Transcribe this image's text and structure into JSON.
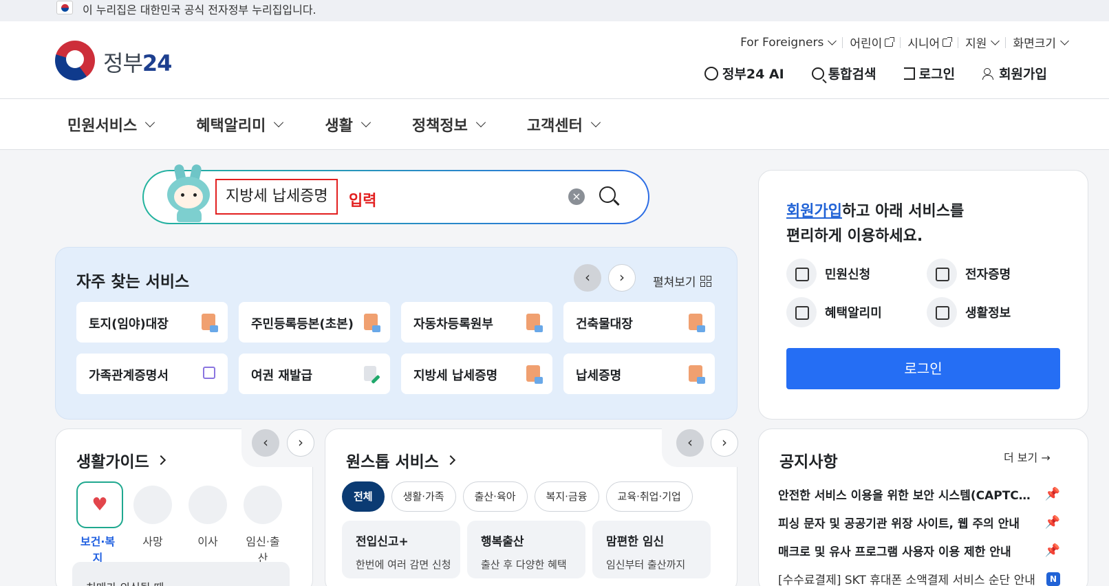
{
  "topbar": {
    "text": "이 누리집은 대한민국 공식 전자정부 누리집입니다."
  },
  "logo": {
    "text": "정부",
    "num": "24"
  },
  "util_links": [
    {
      "label": "For Foreigners",
      "icon": "chevron-down-icon"
    },
    {
      "label": "어린이",
      "icon": "external-link-icon"
    },
    {
      "label": "시니어",
      "icon": "external-link-icon"
    },
    {
      "label": "지원",
      "icon": "chevron-down-icon"
    },
    {
      "label": "화면크기",
      "icon": "chevron-down-icon"
    }
  ],
  "actions": {
    "ai": "정부24 AI",
    "search": "통합검색",
    "login": "로그인",
    "signup": "회원가입"
  },
  "gnb": [
    "민원서비스",
    "혜택알리미",
    "생활",
    "정책정보",
    "고객센터"
  ],
  "search": {
    "query": "지방세 납세증명",
    "annotation": "입력",
    "clear": "×"
  },
  "frequent": {
    "title": "자주 찾는 서비스",
    "prev": "‹",
    "next": "›",
    "expand": "펼쳐보기",
    "items": [
      {
        "label": "토지(임야)대장",
        "icon": "document-icon"
      },
      {
        "label": "주민등록등본(초본)",
        "icon": "document-icon"
      },
      {
        "label": "자동차등록원부",
        "icon": "document-icon"
      },
      {
        "label": "건축물대장",
        "icon": "document-icon"
      },
      {
        "label": "가족관계증명서",
        "icon": "external-link-icon"
      },
      {
        "label": "여권 재발급",
        "icon": "edit-icon"
      },
      {
        "label": "지방세 납세증명",
        "icon": "document-icon"
      },
      {
        "label": "납세증명",
        "icon": "document-icon"
      }
    ]
  },
  "login_panel": {
    "msg_link": "회원가입",
    "msg_rest": "하고 아래 서비스를",
    "msg_line2": "편리하게 이용하세요.",
    "quick": [
      "민원신청",
      "전자증명",
      "혜택알리미",
      "생활정보"
    ],
    "button": "로그인"
  },
  "life_guide": {
    "title": "생활가이드",
    "prev": "‹",
    "next": "›",
    "items": [
      "보건·복지",
      "사망",
      "이사",
      "임신·출산"
    ],
    "sub_item": "치매가 의심될 때"
  },
  "one_stop": {
    "title": "원스톱 서비스",
    "prev": "‹",
    "next": "›",
    "chips": [
      "전체",
      "생활·가족",
      "출산·육아",
      "복지·금융",
      "교육·취업·기업"
    ],
    "cards": [
      {
        "title": "전입신고+",
        "desc": "한번에 여러 감면 신청"
      },
      {
        "title": "행복출산",
        "desc": "출산 후 다양한 혜택"
      },
      {
        "title": "맘편한 임신",
        "desc": "임신부터 출산까지"
      }
    ]
  },
  "notice": {
    "title": "공지사항",
    "more": "더 보기 →",
    "items": [
      {
        "text": "안전한 서비스 이용을 위한 보안 시스템(CAPTCHA) 도입 안내",
        "icon": "pin-icon"
      },
      {
        "text": "피싱 문자 및 공공기관 위장 사이트, 웹 주의 안내",
        "icon": "pin-icon"
      },
      {
        "text": "매크로 및 유사 프로그램 사용자 이용 제한 안내",
        "icon": "pin-icon"
      },
      {
        "text": "[수수료결제] SKT 휴대폰 소액결제 서비스 순단 안내",
        "badge": "N"
      }
    ]
  }
}
